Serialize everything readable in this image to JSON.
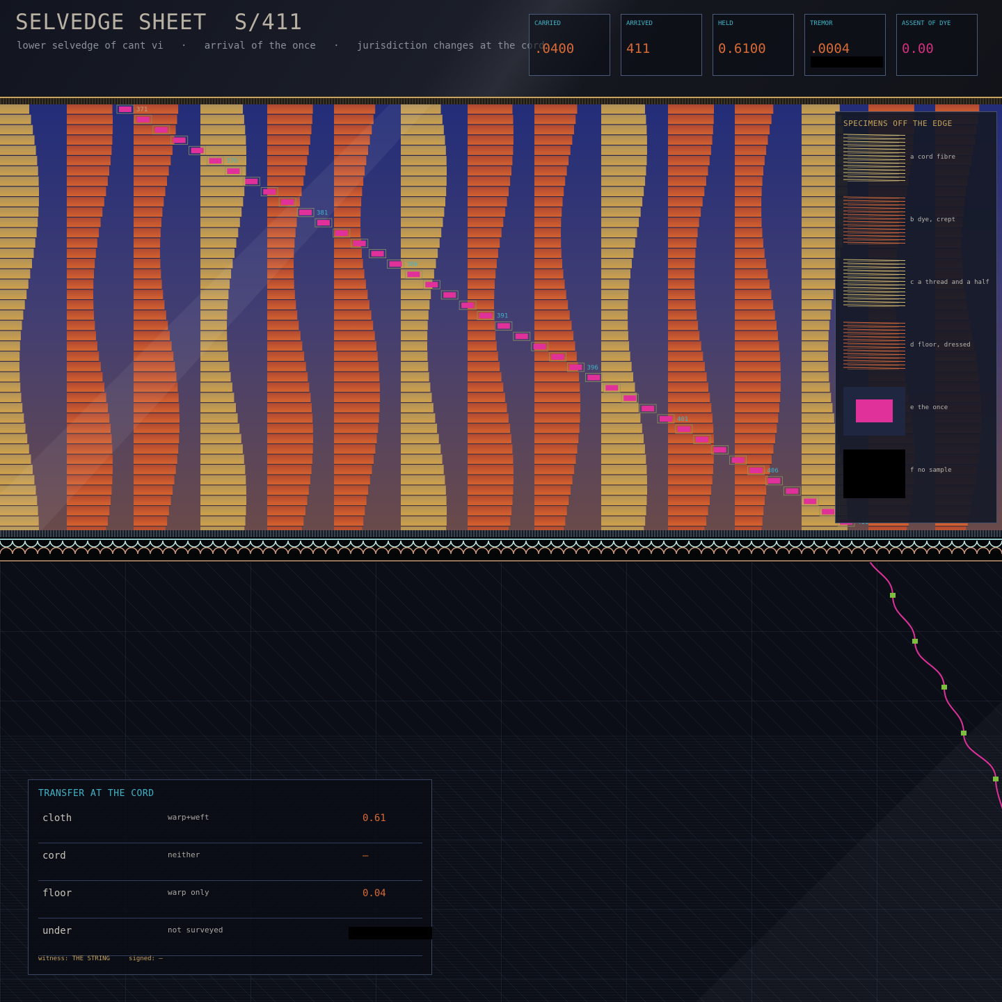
{
  "header": {
    "title": "SELVEDGE SHEET  S/411",
    "subtitle": "lower selvedge of cant vi   ·   arrival of the once   ·   jurisdiction changes at the cord",
    "stats": [
      {
        "label": "CARRIED",
        "value": ".0400"
      },
      {
        "label": "ARRIVED",
        "value": "411"
      },
      {
        "label": "HELD",
        "value": "0.6100"
      },
      {
        "label": "TREMOR",
        "value": ".0004"
      },
      {
        "label": "ASSENT OF DYE",
        "value": "0.00"
      }
    ]
  },
  "markers": [
    "371",
    "376",
    "381",
    "386",
    "391",
    "396",
    "401",
    "406",
    "411"
  ],
  "specimens": {
    "title": "SPECIMENS OFF THE EDGE",
    "items": [
      {
        "label": "a cord fibre",
        "kind": "yellow-threads"
      },
      {
        "label": "b dye, crept",
        "kind": "orange-threads"
      },
      {
        "label": "c a thread and a half",
        "kind": "yellow-threads"
      },
      {
        "label": "d floor, dressed",
        "kind": "orange-threads"
      },
      {
        "label": "e the once",
        "kind": "magenta-block"
      },
      {
        "label": "f no sample",
        "kind": "black"
      }
    ]
  },
  "transfer": {
    "title": "TRANSFER AT THE CORD",
    "rows": [
      {
        "key": "cloth",
        "mode": "warp+weft",
        "value": "0.61"
      },
      {
        "key": "cord",
        "mode": "neither",
        "value": "—"
      },
      {
        "key": "floor",
        "mode": "warp only",
        "value": "0.04"
      },
      {
        "key": "under",
        "mode": "not surveyed",
        "value": ""
      }
    ],
    "footer": "witness: THE STRING     signed: —"
  },
  "colors": {
    "accent_cyan": "#3fb4c8",
    "accent_orange": "#d86a35",
    "accent_gold": "#c7a35c",
    "marker_magenta": "#e0309a",
    "node_green": "#7bbf3a",
    "weave_blue": "#26307a",
    "weave_yellow": "#c9a65a",
    "weave_orange": "#d05a2a"
  }
}
